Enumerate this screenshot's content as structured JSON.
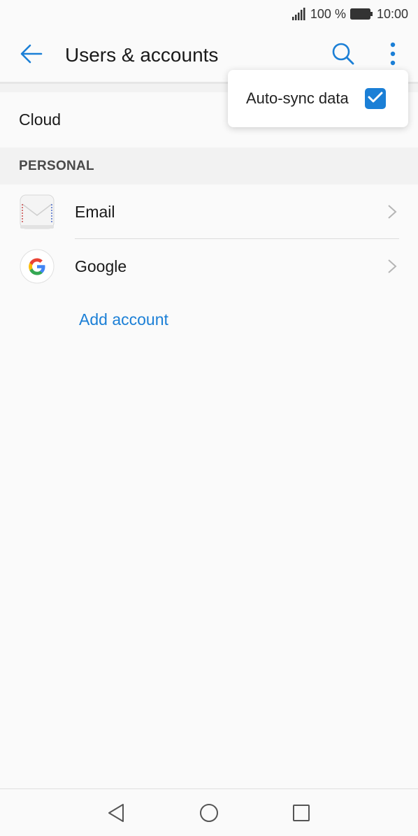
{
  "status_bar": {
    "battery_percent": "100 %",
    "time": "10:00"
  },
  "app_bar": {
    "title": "Users & accounts",
    "back_icon": "arrow-left-icon",
    "search_icon": "search-icon",
    "more_icon": "more-vert-icon"
  },
  "cloud": {
    "label": "Cloud"
  },
  "personal": {
    "header": "PERSONAL",
    "accounts": [
      {
        "label": "Email",
        "icon": "email-envelope-icon"
      },
      {
        "label": "Google",
        "icon": "google-logo-icon"
      }
    ],
    "add_account_label": "Add account"
  },
  "popup_menu": {
    "items": [
      {
        "label": "Auto-sync data",
        "checked": true
      }
    ]
  },
  "colors": {
    "accent": "#1b7fd6",
    "background": "#fafafa",
    "section_bg": "#f2f2f2"
  },
  "nav_bar": {
    "back_icon": "triangle-back-icon",
    "home_icon": "circle-home-icon",
    "recents_icon": "square-recents-icon"
  }
}
